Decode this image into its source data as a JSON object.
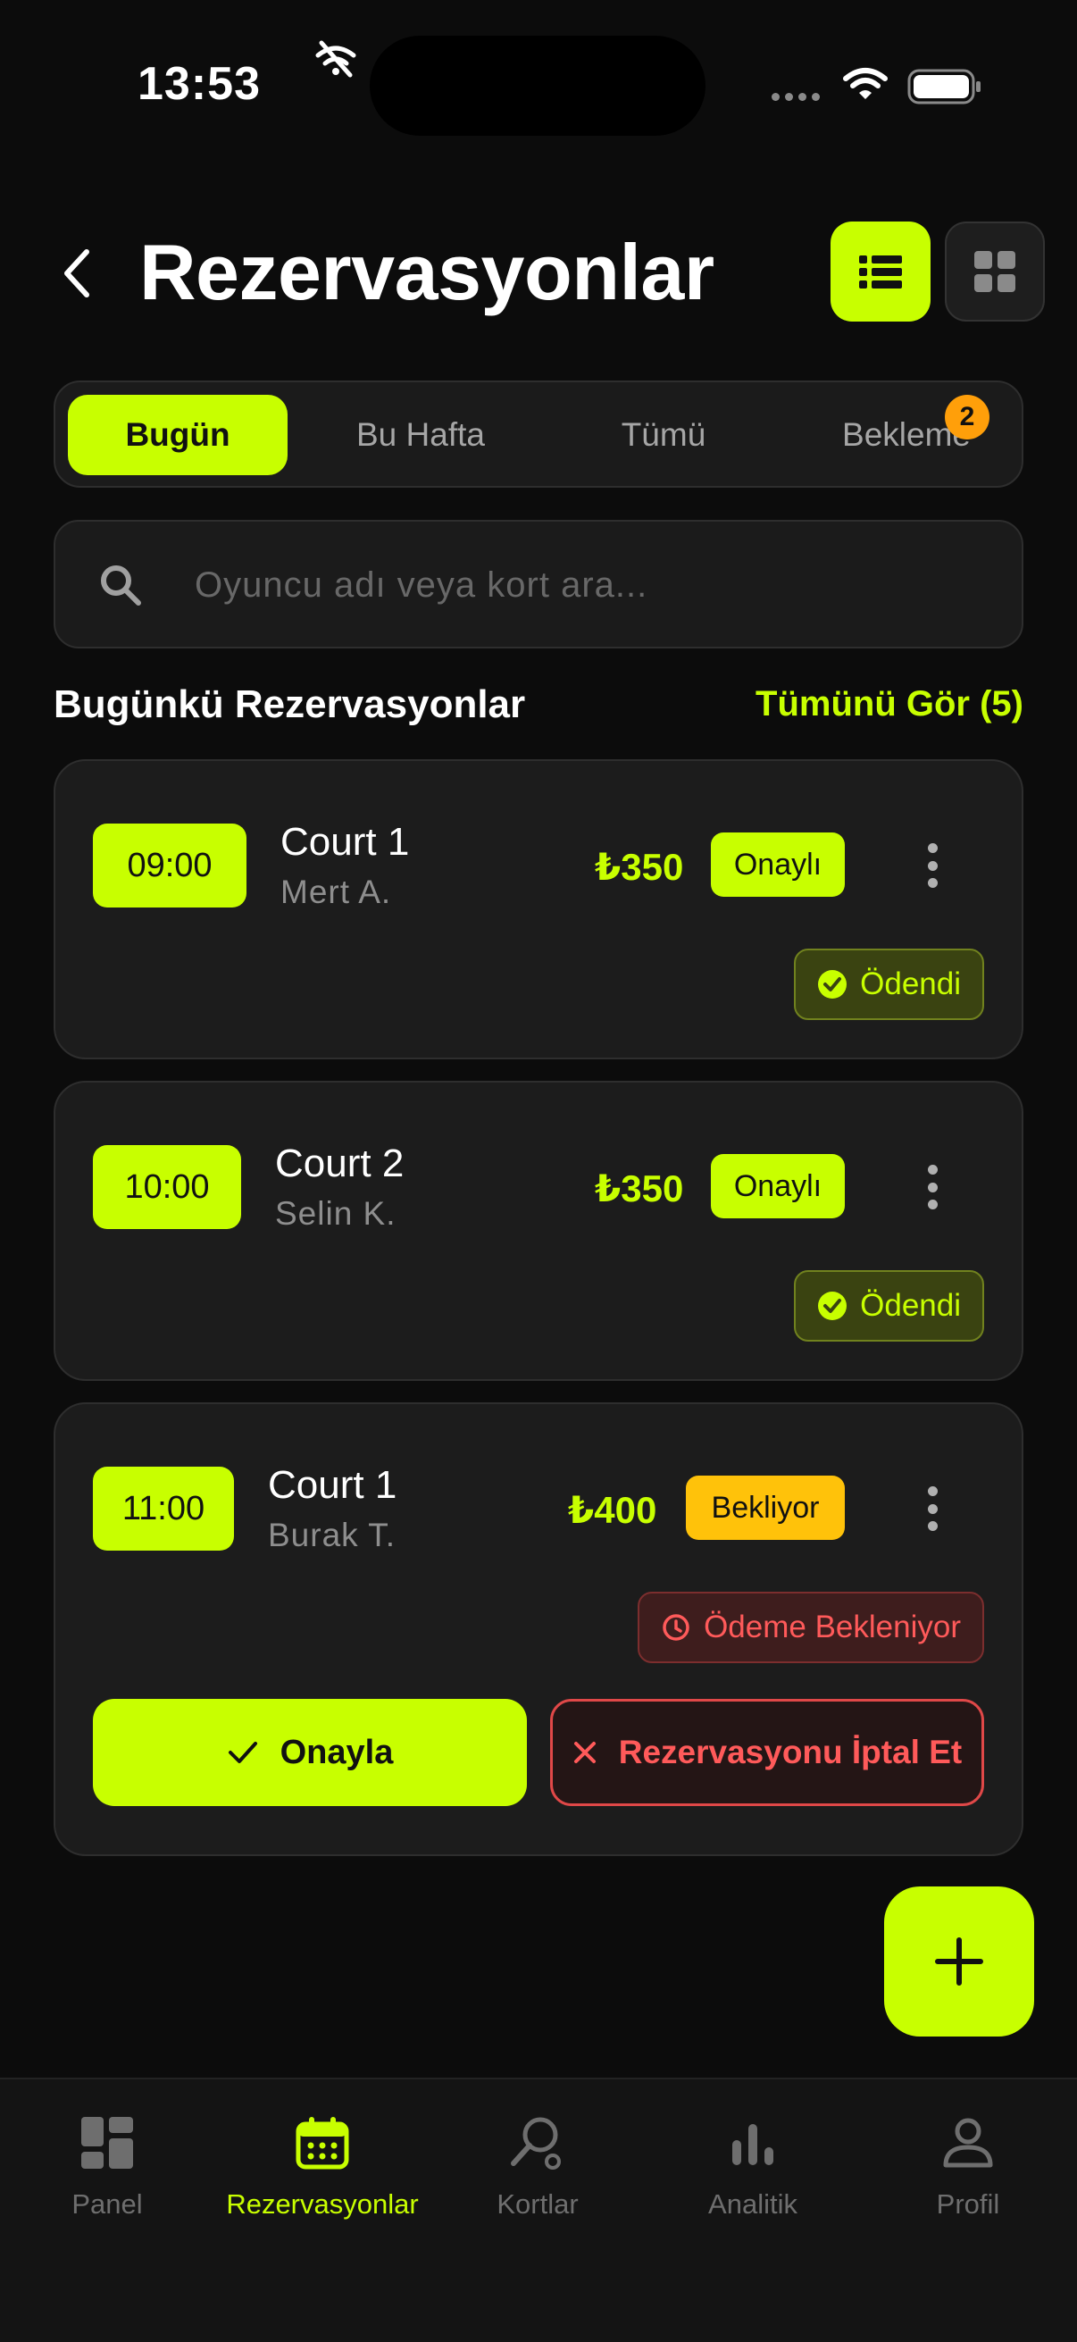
{
  "status_bar": {
    "time": "13:53"
  },
  "header": {
    "title": "Rezervasyonlar"
  },
  "tabs": [
    {
      "label": "Bugün",
      "active": true
    },
    {
      "label": "Bu Hafta",
      "active": false
    },
    {
      "label": "Tümü",
      "active": false
    },
    {
      "label": "Bekleme",
      "active": false,
      "badge": "2"
    }
  ],
  "search": {
    "placeholder": "Oyuncu adı veya kort ara..."
  },
  "section": {
    "title": "Bugünkü Rezervasyonlar",
    "link": "Tümünü Gör (5)"
  },
  "bookings": [
    {
      "time": "09:00",
      "court": "Court 1",
      "player": "Mert A.",
      "price": "₺350",
      "status": "Onaylı",
      "payment": "Ödendi"
    },
    {
      "time": "10:00",
      "court": "Court 2",
      "player": "Selin K.",
      "price": "₺350",
      "status": "Onaylı",
      "payment": "Ödendi"
    },
    {
      "time": "11:00",
      "court": "Court 1",
      "player": "Burak T.",
      "price": "₺400",
      "status": "Bekliyor",
      "payment": "Ödeme Bekleniyor",
      "approve_label": "Onayla",
      "cancel_label": "Rezervasyonu İptal Et"
    }
  ],
  "bottom_nav": [
    {
      "label": "Panel",
      "icon": "dashboard-icon",
      "active": false
    },
    {
      "label": "Rezervasyonlar",
      "icon": "calendar-icon",
      "active": true
    },
    {
      "label": "Kortlar",
      "icon": "racket-icon",
      "active": false
    },
    {
      "label": "Analitik",
      "icon": "bar-chart-icon",
      "active": false
    },
    {
      "label": "Profil",
      "icon": "user-icon",
      "active": false
    }
  ],
  "colors": {
    "accent": "#c8ff00",
    "pending": "#ffc20a",
    "danger": "#ff5a5a",
    "background": "#0c0c0c",
    "card": "#1c1c1c"
  }
}
